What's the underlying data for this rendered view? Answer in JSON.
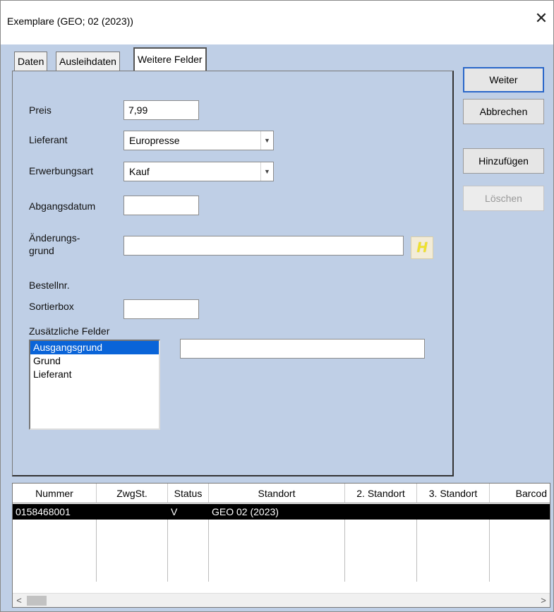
{
  "window": {
    "title": "Exemplare (GEO; 02 (2023))"
  },
  "tabs": [
    {
      "label": "Daten"
    },
    {
      "label": "Ausleihdaten"
    },
    {
      "label": "Weitere Felder"
    }
  ],
  "form": {
    "preis": {
      "label": "Preis",
      "value": "7,99"
    },
    "lieferant": {
      "label": "Lieferant",
      "value": "Europresse"
    },
    "erwerbungsart": {
      "label": "Erwerbungsart",
      "value": "Kauf"
    },
    "abgangsdatum": {
      "label": "Abgangsdatum",
      "value": ""
    },
    "aenderungsgrund": {
      "label_line1": "Änderungs-",
      "label_line2": "grund",
      "value": "",
      "button_text": "H"
    },
    "bestellnr": {
      "label": "Bestellnr."
    },
    "sortierbox": {
      "label": "Sortierbox",
      "value": ""
    },
    "zusaetzliche": {
      "label": "Zusätzliche Felder",
      "items": [
        "Ausgangsgrund",
        "Grund",
        "Lieferant"
      ],
      "selected_index": 0,
      "value": ""
    }
  },
  "buttons": {
    "weiter": "Weiter",
    "abbrechen": "Abbrechen",
    "hinzufuegen": "Hinzufügen",
    "loeschen": "Löschen"
  },
  "table": {
    "columns": [
      "Nummer",
      "ZwgSt.",
      "Status",
      "Standort",
      "2. Standort",
      "3. Standort",
      "Barcod"
    ],
    "rows": [
      [
        "0158468001",
        "",
        "V",
        "GEO 02 (2023)",
        "",
        "",
        ""
      ]
    ]
  },
  "icons": {
    "close": "close-icon",
    "dropdown": "chevron-down-icon",
    "scroll_left": "chevron-left-icon",
    "scroll_right": "chevron-right-icon"
  },
  "colors": {
    "dialog_bg": "#bfcfe6",
    "selection": "#0a64d8",
    "default_button_border": "#2a67c9",
    "help_button_glyph": "#f0e22a"
  }
}
